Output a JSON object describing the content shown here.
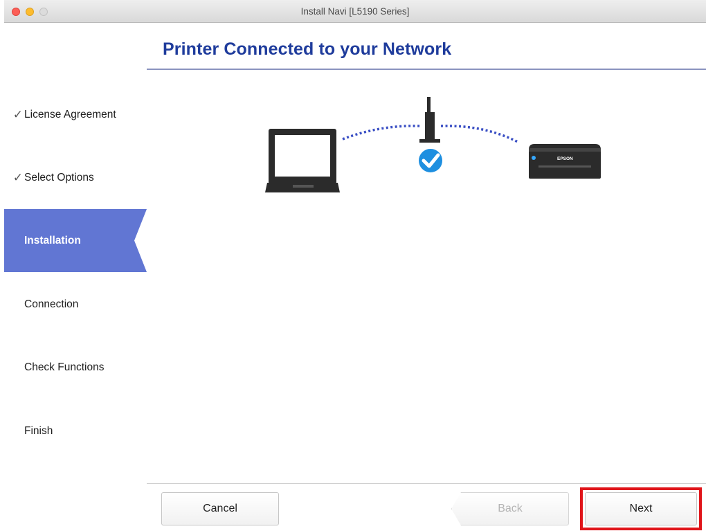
{
  "window": {
    "title": "Install Navi [L5190 Series]"
  },
  "header": {
    "title": "Printer Connected to your Network"
  },
  "sidebar": {
    "steps": [
      {
        "label": "License Agreement",
        "state": "done",
        "icon": "checkmark-icon"
      },
      {
        "label": "Select Options",
        "state": "done",
        "icon": "checkmark-icon"
      },
      {
        "label": "Installation",
        "state": "active"
      },
      {
        "label": "Connection",
        "state": "pending"
      },
      {
        "label": "Check Functions",
        "state": "pending"
      },
      {
        "label": "Finish",
        "state": "pending"
      }
    ]
  },
  "illustration": {
    "printer_brand": "EPSON",
    "icons": [
      "laptop-icon",
      "wireless-router-icon",
      "success-check-icon",
      "printer-icon"
    ]
  },
  "footer": {
    "cancel_label": "Cancel",
    "back_label": "Back",
    "next_label": "Next"
  },
  "colors": {
    "title_blue": "#1f3c9c",
    "active_step": "#6176d3",
    "check_blue": "#1e8fe0",
    "dots_blue": "#3a4fc4",
    "highlight_red": "#e0151a"
  }
}
